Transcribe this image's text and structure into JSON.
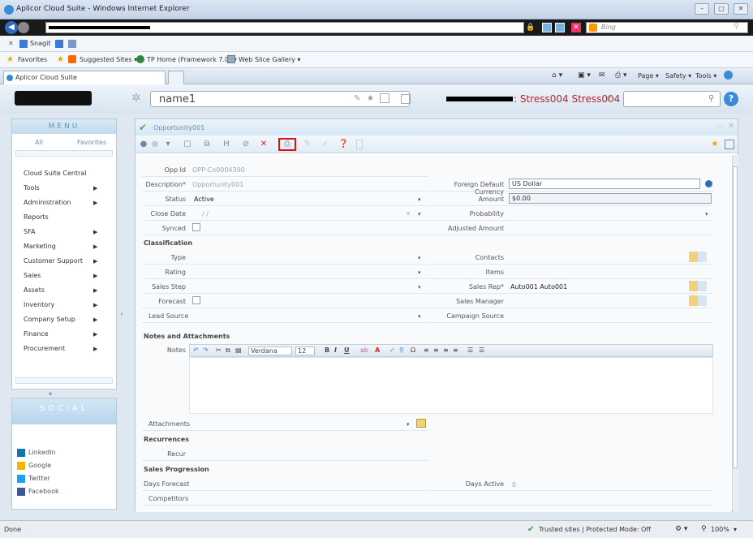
{
  "browser": {
    "window_title": "Aplicor Cloud Suite - Windows Internet Explorer",
    "search_placeholder": "Bing",
    "snagit_label": "Snagit",
    "favorites_label": "Favorites",
    "favorites_items": [
      "Suggested Sites ▾",
      "TP Home (Framework 7.0) ▾",
      "Web Slice Gallery ▾"
    ],
    "tab_label": "Aplicor Cloud Suite",
    "command_items": [
      "Page ▾",
      "Safety ▾",
      "Tools ▾"
    ],
    "status_left": "Done",
    "status_zone": "Trusted sites | Protected Mode: Off",
    "zoom": "100%"
  },
  "app": {
    "record_name": "name1",
    "user_suffix": ": Stress004 Stress004"
  },
  "menu": {
    "title": "MENU",
    "tab_all": "All",
    "tab_favorites": "Favorites",
    "items": [
      {
        "label": "Cloud Suite Central",
        "arrow": ""
      },
      {
        "label": "Tools",
        "arrow": "▶"
      },
      {
        "label": "Administration",
        "arrow": "▶"
      },
      {
        "label": "Reports",
        "arrow": ""
      },
      {
        "label": "SFA",
        "arrow": "▶"
      },
      {
        "label": "Marketing",
        "arrow": "▶"
      },
      {
        "label": "Customer Support",
        "arrow": "▶"
      },
      {
        "label": "Sales",
        "arrow": "▶"
      },
      {
        "label": "Assets",
        "arrow": "▶"
      },
      {
        "label": "Inventory",
        "arrow": "▶"
      },
      {
        "label": "Company Setup",
        "arrow": "▶"
      },
      {
        "label": "Finance",
        "arrow": "▶"
      },
      {
        "label": "Procurement",
        "arrow": "▶"
      }
    ]
  },
  "social": {
    "title": "SOCIAL",
    "items": [
      "LinkedIn",
      "Google",
      "Twitter",
      "Facebook"
    ],
    "colors": [
      "#0e76a8",
      "#f4b400",
      "#1da1f2",
      "#3b5998"
    ]
  },
  "form": {
    "panel_title": "Opportunity001",
    "opp_id_label": "Opp Id",
    "opp_id_value": "OPP-Co0004390",
    "description_label": "Description*",
    "description_value": "Opportunity001",
    "status_label": "Status",
    "status_value": "Active",
    "close_date_label": "Close Date",
    "close_date_value": "/ /",
    "close_date_clear": "x",
    "synced_label": "Synced",
    "currency_label": "Foreign Default Currency",
    "currency_value": "US Dollar",
    "amount_label": "Amount",
    "amount_value": "$0.00",
    "probability_label": "Probability",
    "adjusted_amount_label": "Adjusted Amount",
    "classification_label": "Classification",
    "type_label": "Type",
    "rating_label": "Rating",
    "sales_step_label": "Sales Step",
    "forecast_label": "Forecast",
    "lead_source_label": "Lead Source",
    "contacts_label": "Contacts",
    "items_label": "Items",
    "sales_rep_label": "Sales Rep*",
    "sales_rep_value": "Auto001 Auto001",
    "sales_manager_label": "Sales Manager",
    "campaign_source_label": "Campaign Source",
    "notes_section_label": "Notes and Attachments",
    "notes_label": "Notes",
    "editor_font": "Verdana",
    "editor_size": "12",
    "attachments_label": "Attachments",
    "recurrences_label": "Recurrences",
    "recur_label": "Recur",
    "sales_progression_label": "Sales Progression",
    "days_forecast_label": "Days Forecast",
    "days_active_label": "Days Active",
    "days_active_value": "0",
    "competitors_label": "Competitors"
  },
  "colors": {
    "accent": "#3a8ad8",
    "alert": "#b4282f",
    "highlight": "#dd1111"
  }
}
